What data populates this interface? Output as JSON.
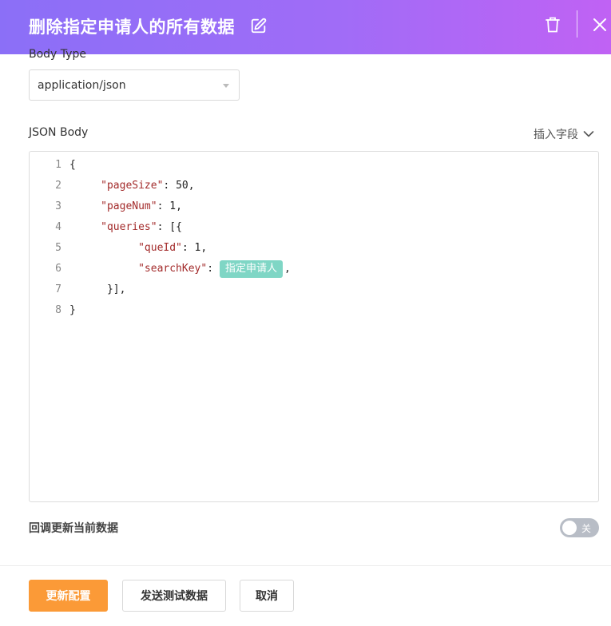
{
  "header": {
    "title": "删除指定申请人的所有数据"
  },
  "form": {
    "body_type_label": "Body Type",
    "body_type_value": "application/json",
    "json_body_label": "JSON Body",
    "insert_field_label": "插入字段"
  },
  "editor": {
    "lines": [
      {
        "num": "1",
        "indent": "",
        "pre": "{",
        "key": "",
        "post": "",
        "tag": "",
        "after_tag": ""
      },
      {
        "num": "2",
        "indent": "     ",
        "pre": "",
        "key": "\"pageSize\"",
        "post": ": 50,",
        "tag": "",
        "after_tag": ""
      },
      {
        "num": "3",
        "indent": "     ",
        "pre": "",
        "key": "\"pageNum\"",
        "post": ": 1,",
        "tag": "",
        "after_tag": ""
      },
      {
        "num": "4",
        "indent": "     ",
        "pre": "",
        "key": "\"queries\"",
        "post": ": [{",
        "tag": "",
        "after_tag": ""
      },
      {
        "num": "5",
        "indent": "           ",
        "pre": "",
        "key": "\"queId\"",
        "post": ": 1,",
        "tag": "",
        "after_tag": ""
      },
      {
        "num": "6",
        "indent": "           ",
        "pre": "",
        "key": "\"searchKey\"",
        "post": ":",
        "tag": "指定申请人",
        "after_tag": ","
      },
      {
        "num": "7",
        "indent": "      ",
        "pre": "}],",
        "key": "",
        "post": "",
        "tag": "",
        "after_tag": ""
      },
      {
        "num": "8",
        "indent": "",
        "pre": "}",
        "key": "",
        "post": "",
        "tag": "",
        "after_tag": ""
      }
    ]
  },
  "callback": {
    "label": "回调更新当前数据",
    "toggle_text": "关",
    "toggle_on": false
  },
  "footer": {
    "update_label": "更新配置",
    "send_test_label": "发送测试数据",
    "cancel_label": "取消"
  },
  "colors": {
    "header_gradient_start": "#8b6ff7",
    "header_gradient_end": "#c062f4",
    "primary_button": "#fb9a37",
    "variable_tag": "#7fd6c5",
    "json_key": "#a32b2b"
  }
}
